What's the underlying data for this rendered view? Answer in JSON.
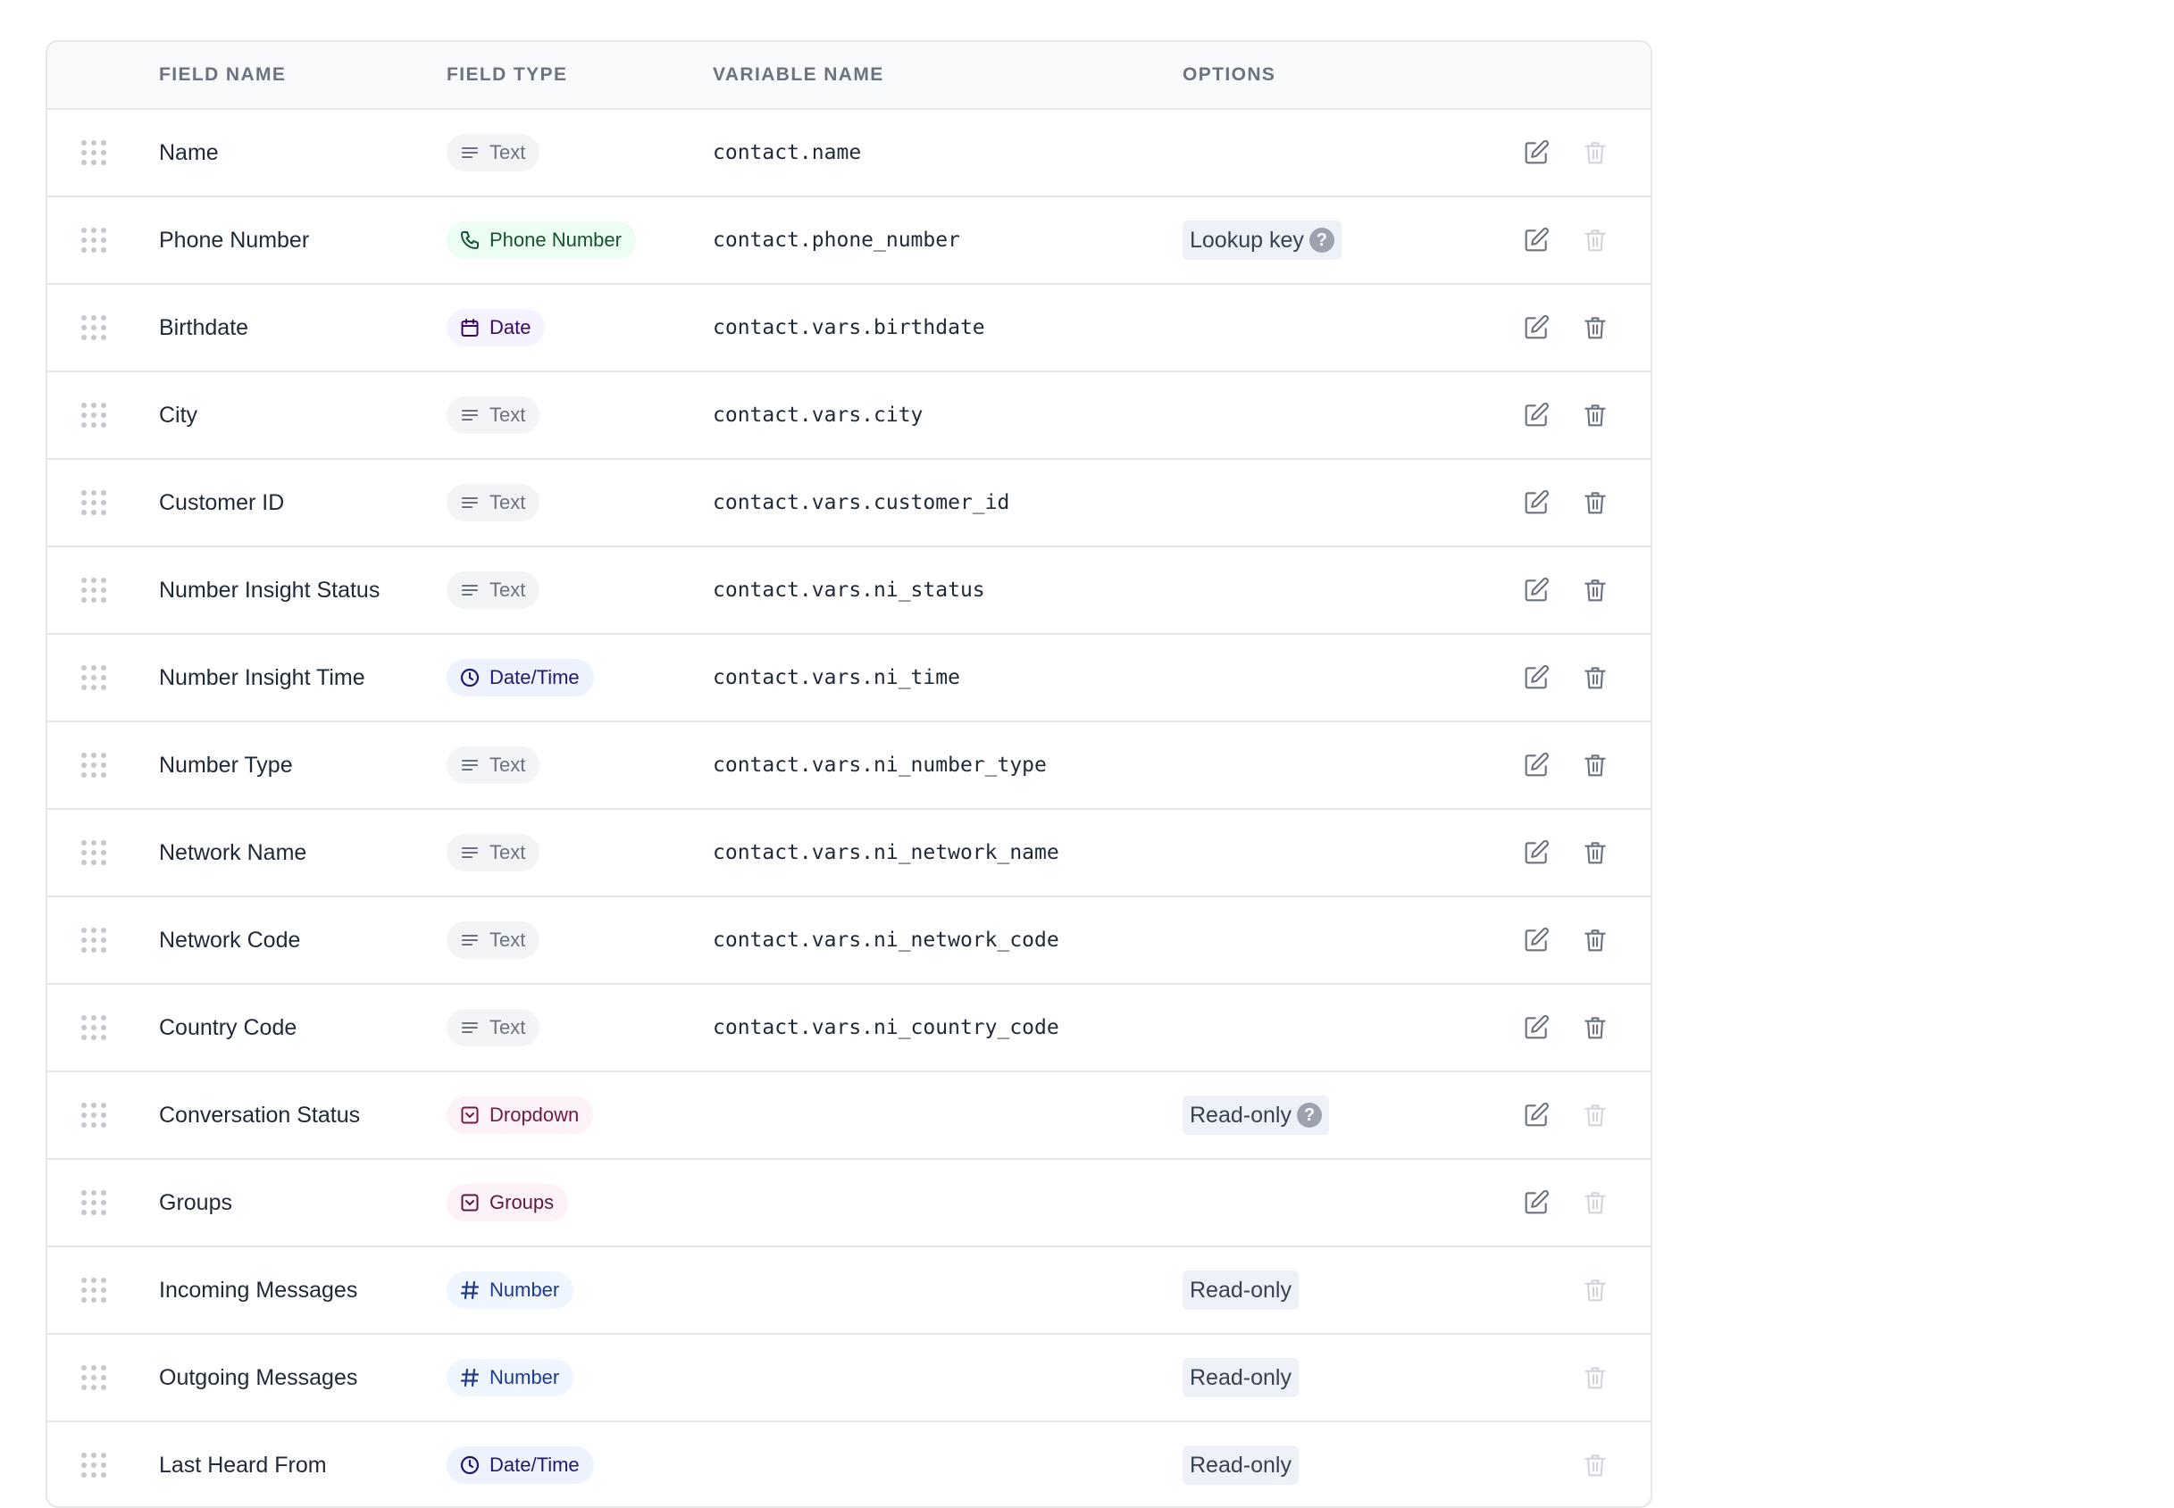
{
  "header": {
    "field_name": "FIELD NAME",
    "field_type": "FIELD TYPE",
    "variable_name": "VARIABLE NAME",
    "options": "OPTIONS"
  },
  "icons": {
    "drag": "drag-handle-icon",
    "edit": "edit-icon",
    "delete": "trash-icon",
    "help": "question-circle-icon"
  },
  "colors": {
    "accent_border": "#e5e7eb",
    "header_bg": "#f9fafb",
    "option_bg": "#eef2f8"
  },
  "rows": [
    {
      "name": "Name",
      "type": "Text",
      "type_key": "text",
      "variable": "contact.name",
      "option": "",
      "option_help": false,
      "editable": true,
      "deletable": false
    },
    {
      "name": "Phone Number",
      "type": "Phone Number",
      "type_key": "phone",
      "variable": "contact.phone_number",
      "option": "Lookup key",
      "option_help": true,
      "editable": true,
      "deletable": false
    },
    {
      "name": "Birthdate",
      "type": "Date",
      "type_key": "date",
      "variable": "contact.vars.birthdate",
      "option": "",
      "option_help": false,
      "editable": true,
      "deletable": true
    },
    {
      "name": "City",
      "type": "Text",
      "type_key": "text",
      "variable": "contact.vars.city",
      "option": "",
      "option_help": false,
      "editable": true,
      "deletable": true
    },
    {
      "name": "Customer ID",
      "type": "Text",
      "type_key": "text",
      "variable": "contact.vars.customer_id",
      "option": "",
      "option_help": false,
      "editable": true,
      "deletable": true
    },
    {
      "name": "Number Insight Status",
      "type": "Text",
      "type_key": "text",
      "variable": "contact.vars.ni_status",
      "option": "",
      "option_help": false,
      "editable": true,
      "deletable": true
    },
    {
      "name": "Number Insight Time",
      "type": "Date/Time",
      "type_key": "datetime",
      "variable": "contact.vars.ni_time",
      "option": "",
      "option_help": false,
      "editable": true,
      "deletable": true
    },
    {
      "name": "Number Type",
      "type": "Text",
      "type_key": "text",
      "variable": "contact.vars.ni_number_type",
      "option": "",
      "option_help": false,
      "editable": true,
      "deletable": true
    },
    {
      "name": "Network Name",
      "type": "Text",
      "type_key": "text",
      "variable": "contact.vars.ni_network_name",
      "option": "",
      "option_help": false,
      "editable": true,
      "deletable": true
    },
    {
      "name": "Network Code",
      "type": "Text",
      "type_key": "text",
      "variable": "contact.vars.ni_network_code",
      "option": "",
      "option_help": false,
      "editable": true,
      "deletable": true
    },
    {
      "name": "Country Code",
      "type": "Text",
      "type_key": "text",
      "variable": "contact.vars.ni_country_code",
      "option": "",
      "option_help": false,
      "editable": true,
      "deletable": true
    },
    {
      "name": "Conversation Status",
      "type": "Dropdown",
      "type_key": "dropdown",
      "variable": "",
      "option": "Read-only",
      "option_help": true,
      "editable": true,
      "deletable": false
    },
    {
      "name": "Groups",
      "type": "Groups",
      "type_key": "groups",
      "variable": "",
      "option": "",
      "option_help": false,
      "editable": true,
      "deletable": false
    },
    {
      "name": "Incoming Messages",
      "type": "Number",
      "type_key": "number",
      "variable": "",
      "option": "Read-only",
      "option_help": false,
      "editable": false,
      "deletable": false
    },
    {
      "name": "Outgoing Messages",
      "type": "Number",
      "type_key": "number",
      "variable": "",
      "option": "Read-only",
      "option_help": false,
      "editable": false,
      "deletable": false
    },
    {
      "name": "Last Heard From",
      "type": "Date/Time",
      "type_key": "datetime",
      "variable": "",
      "option": "Read-only",
      "option_help": false,
      "editable": false,
      "deletable": false
    }
  ]
}
